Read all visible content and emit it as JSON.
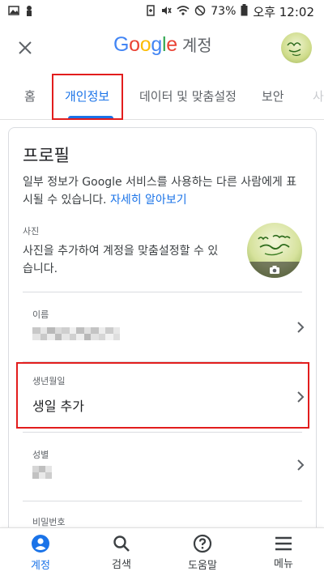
{
  "status_bar": {
    "battery": "73%",
    "time": "오후 12:02"
  },
  "header": {
    "brand_letters": [
      "G",
      "o",
      "o",
      "g",
      "l",
      "e"
    ],
    "brand_colors": [
      "#4285F4",
      "#EA4335",
      "#FBBC05",
      "#4285F4",
      "#34A853",
      "#EA4335"
    ],
    "account_label": "계정"
  },
  "tabs": [
    {
      "label": "홈"
    },
    {
      "label": "개인정보",
      "active": true
    },
    {
      "label": "데이터 및 맞춤설정"
    },
    {
      "label": "보안"
    },
    {
      "label": "사"
    }
  ],
  "profile": {
    "title": "프로필",
    "description": "일부 정보가 Google 서비스를 사용하는 다른 사람에게 표시될 수 있습니다.",
    "learn_more": "자세히 알아보기",
    "photo": {
      "label": "사진",
      "description": "사진을 추가하여 계정을 맞춤설정할 수 있습니다."
    },
    "rows": [
      {
        "label": "이름",
        "value": ""
      },
      {
        "label": "생년월일",
        "value": "생일 추가"
      },
      {
        "label": "성별",
        "value": ""
      },
      {
        "label": "비밀번호",
        "value": ""
      }
    ]
  },
  "bottom_nav": [
    {
      "label": "계정",
      "icon": "account-icon",
      "active": true
    },
    {
      "label": "검색",
      "icon": "search-icon"
    },
    {
      "label": "도움말",
      "icon": "help-icon"
    },
    {
      "label": "메뉴",
      "icon": "menu-icon"
    }
  ],
  "colors": {
    "accent": "#1a73e8",
    "highlight": "#e21d1d"
  }
}
